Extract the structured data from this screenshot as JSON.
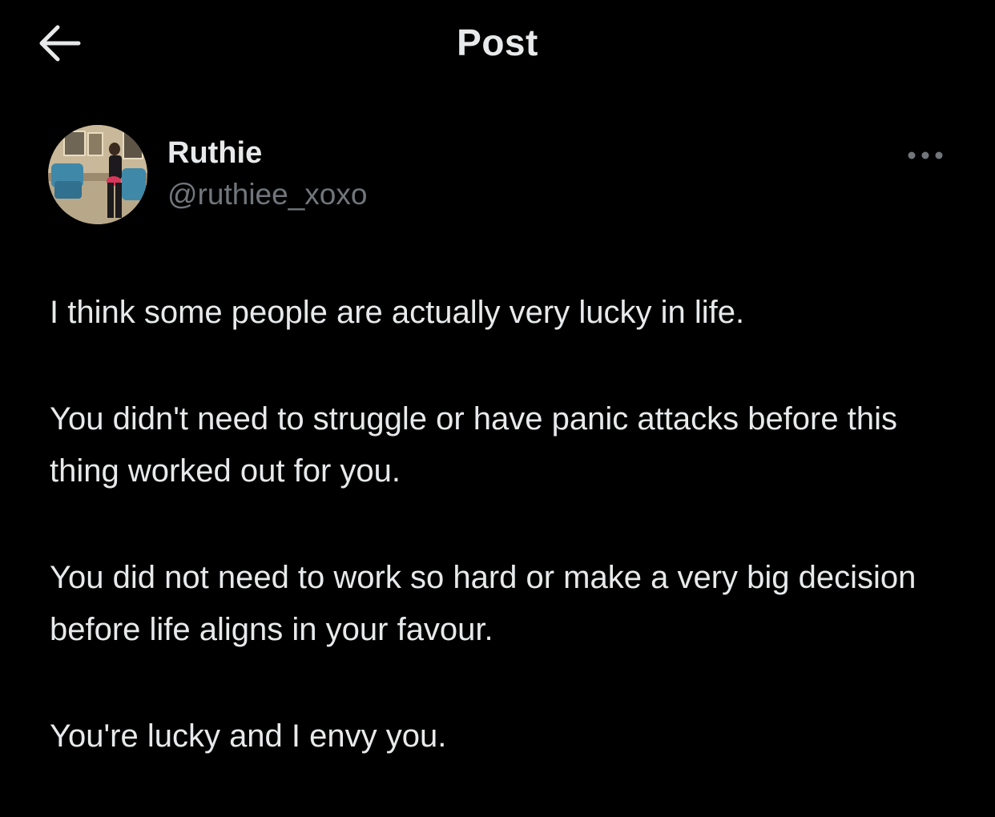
{
  "header": {
    "back_icon": "arrow-left-icon",
    "title": "Post"
  },
  "author": {
    "display_name": "Ruthie",
    "handle": "@ruthiee_xoxo",
    "more_icon": "more-horizontal-icon"
  },
  "post": {
    "paragraphs": [
      "I think some people are actually very lucky in life.",
      "You didn't need to struggle or have panic attacks before this thing worked out for you.",
      "You did not need to work so hard or make a very big decision before life aligns in your favour.",
      "You're lucky and I envy you."
    ]
  },
  "colors": {
    "background": "#000000",
    "primary_text": "#e7e9ea",
    "secondary_text": "#71767b"
  }
}
